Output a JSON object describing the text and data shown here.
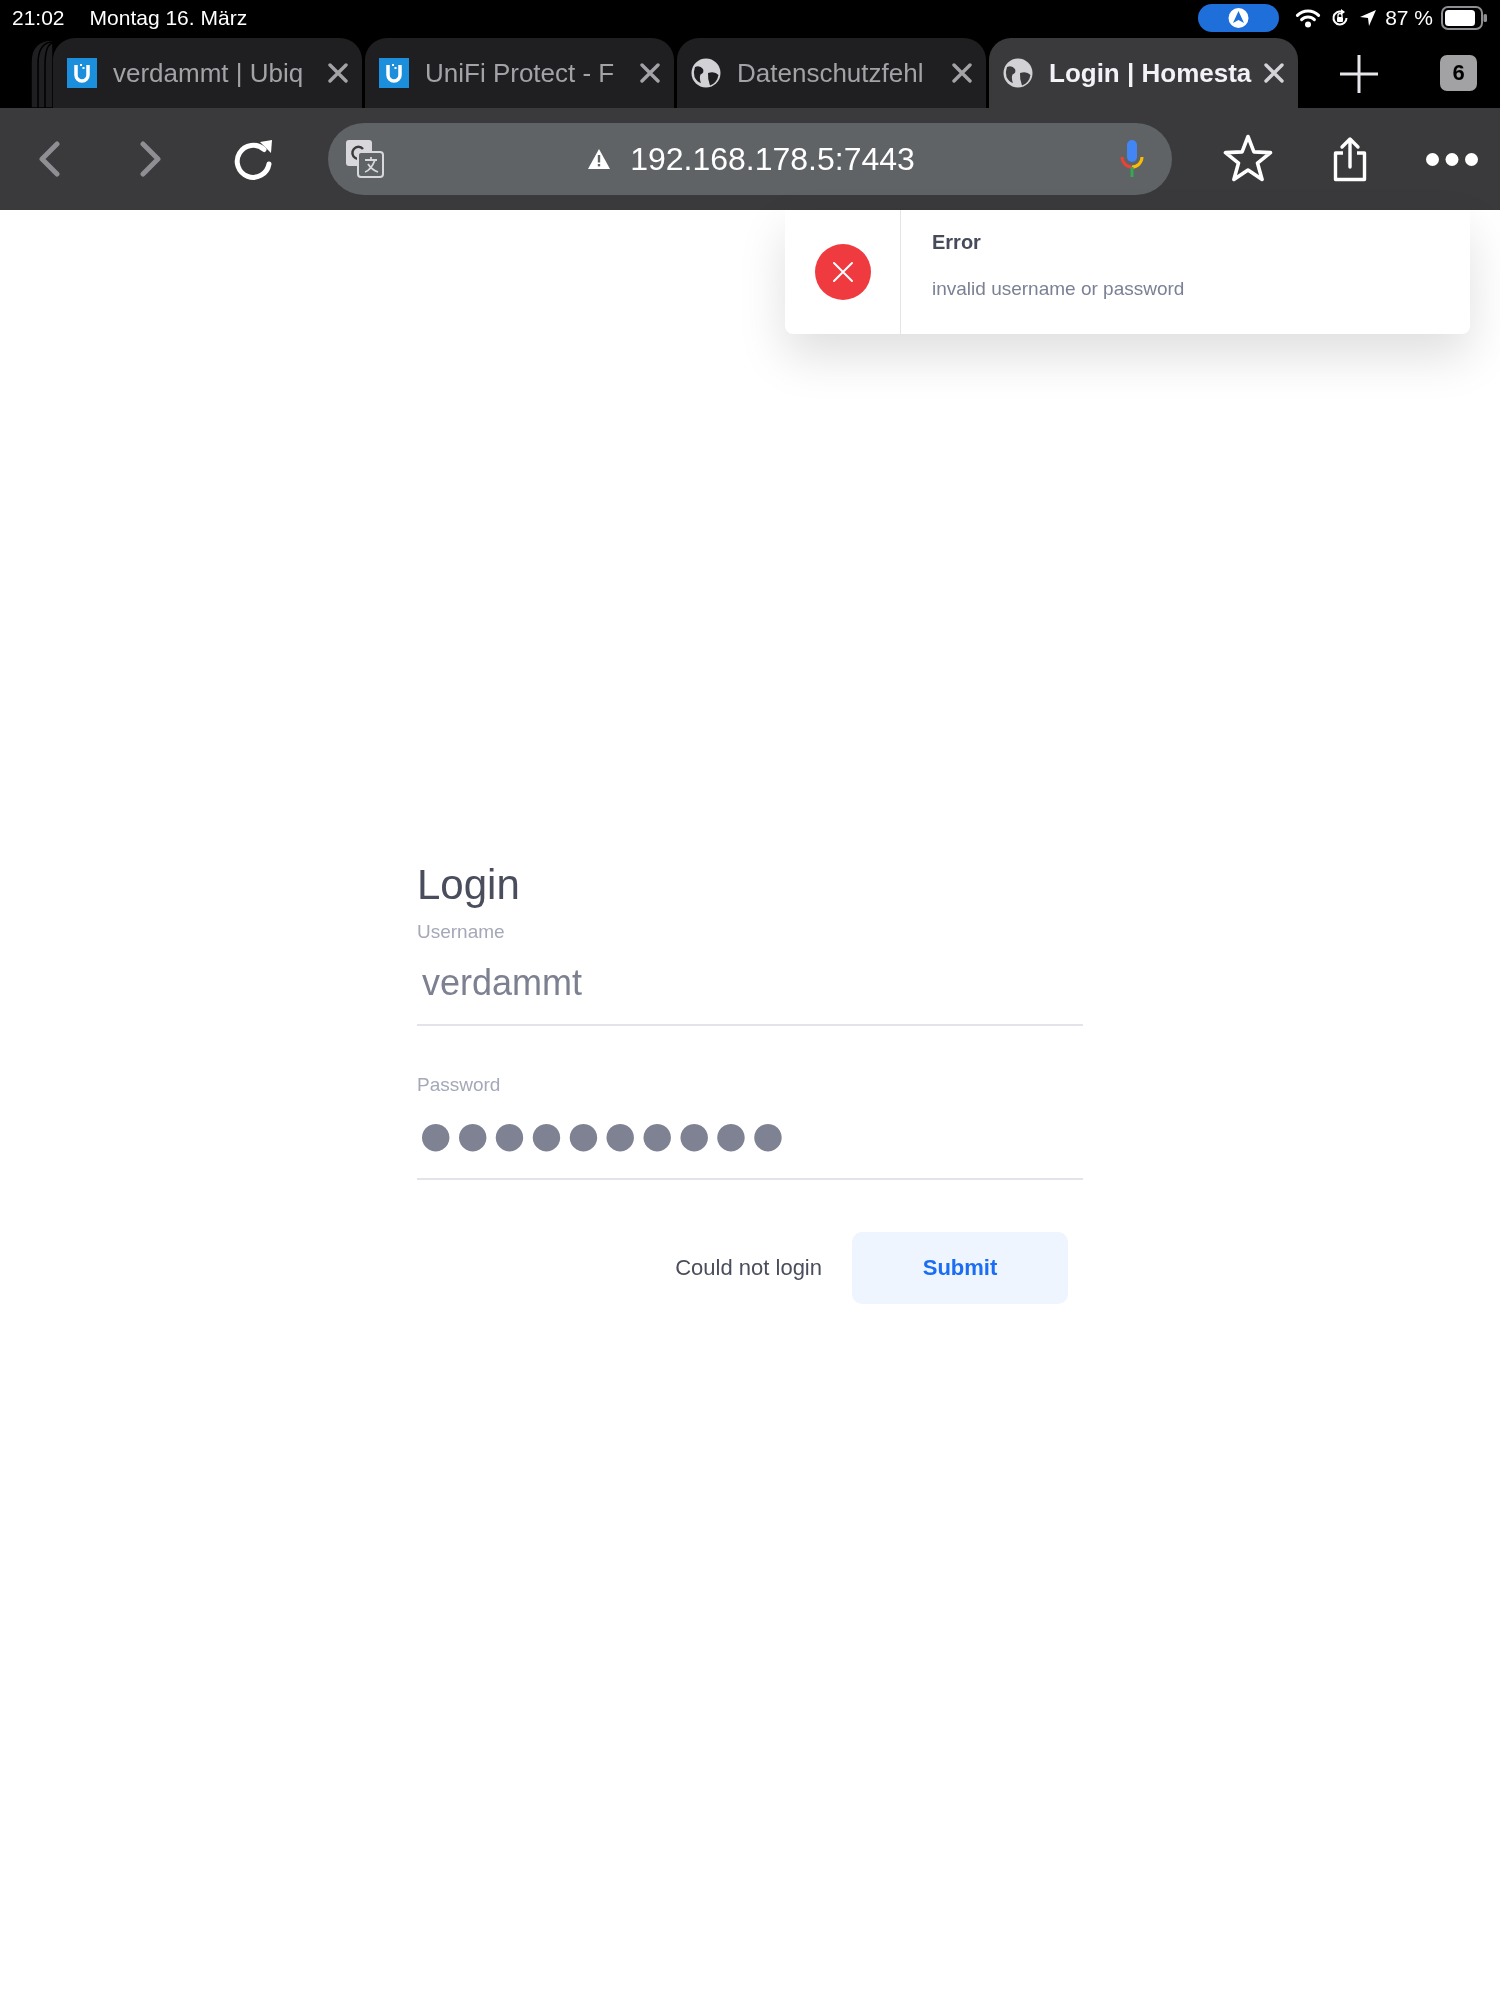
{
  "status_bar": {
    "time": "21:02",
    "date": "Montag 16. März",
    "battery": "87 %"
  },
  "tabs": [
    {
      "title": "verdammt | Ubiq",
      "kind": "unifi",
      "selected": false
    },
    {
      "title": "UniFi Protect - F",
      "kind": "unifi",
      "selected": false
    },
    {
      "title": "Datenschutzfehl",
      "kind": "globe",
      "selected": false
    },
    {
      "title": "Login | Homesta",
      "kind": "globe",
      "selected": true
    }
  ],
  "tab_count": "6",
  "toolbar": {
    "back": {
      "disabled": true
    },
    "forward": {
      "disabled": true
    },
    "url": "192.168.178.5:7443",
    "not_secure": true
  },
  "toast": {
    "kind": "error",
    "title": "Error",
    "message": "invalid username or password"
  },
  "login": {
    "title": "Login",
    "fields": [
      {
        "kind": "text",
        "label": "Username",
        "value": "verdammt"
      },
      {
        "kind": "password",
        "label": "Password",
        "value": "●●●●●●●●●●"
      }
    ],
    "status": "Could not login",
    "button": "Submit"
  }
}
